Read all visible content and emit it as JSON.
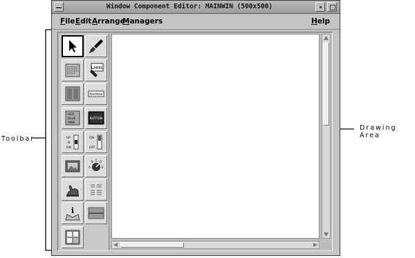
{
  "window": {
    "title": "Window Component Editor: MAINWIN (500x500)"
  },
  "menubar": {
    "file": {
      "mnemonic": "F",
      "rest": "ile"
    },
    "edit": {
      "mnemonic": "E",
      "rest": "dit"
    },
    "arrange": {
      "mnemonic": "A",
      "rest": "rrange"
    },
    "managers": {
      "mnemonic": "M",
      "rest": "anagers"
    },
    "help": {
      "mnemonic": "H",
      "rest": "elp"
    }
  },
  "toolbar": {
    "tools": [
      {
        "icon": "pointer-icon",
        "selected": true
      },
      {
        "icon": "paint-brush-icon"
      },
      {
        "icon": "text-field-icon"
      },
      {
        "icon": "label-icon",
        "text": "LABEL"
      },
      {
        "icon": "panel-icon"
      },
      {
        "icon": "textbox-icon",
        "text": "textbox"
      },
      {
        "icon": "list-icon",
        "text": "RED BLUE PINK"
      },
      {
        "icon": "button-icon",
        "text": "BUTTON"
      },
      {
        "icon": "option-toggle-icon",
        "text": "UP B DN"
      },
      {
        "icon": "scale-icon",
        "text": "ON OFF"
      },
      {
        "icon": "picture-icon"
      },
      {
        "icon": "dial-icon",
        "text": "A B C D E"
      },
      {
        "icon": "hand-pointer-icon"
      },
      {
        "icon": "grid-icon"
      },
      {
        "icon": "info-icon",
        "text": "i"
      },
      {
        "icon": "separator-icon"
      },
      {
        "icon": "window-icon"
      }
    ]
  },
  "annotations": {
    "toolbar": "Toolbar",
    "drawing_area": "Drawing Area"
  }
}
